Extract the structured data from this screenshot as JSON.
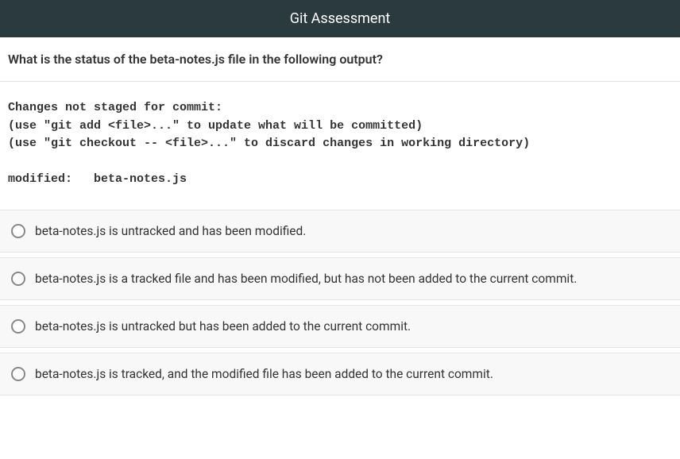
{
  "header": {
    "title": "Git Assessment"
  },
  "question": {
    "prompt": "What is the status of the beta-notes.js file in the following output?"
  },
  "code": {
    "line1": "Changes not staged for commit:",
    "line2": "(use \"git add <file>...\" to update what will be committed)",
    "line3": "(use \"git checkout -- <file>...\" to discard changes in working directory)",
    "line4": "",
    "line5": "modified:   beta-notes.js"
  },
  "options": [
    {
      "label": "beta-notes.js is untracked and has been modified."
    },
    {
      "label": "beta-notes.js is a tracked file and has been modified, but has not been added to the current commit."
    },
    {
      "label": "beta-notes.js is untracked but has been added to the current commit."
    },
    {
      "label": "beta-notes.js is tracked, and the modified file has been added to the current commit."
    }
  ]
}
